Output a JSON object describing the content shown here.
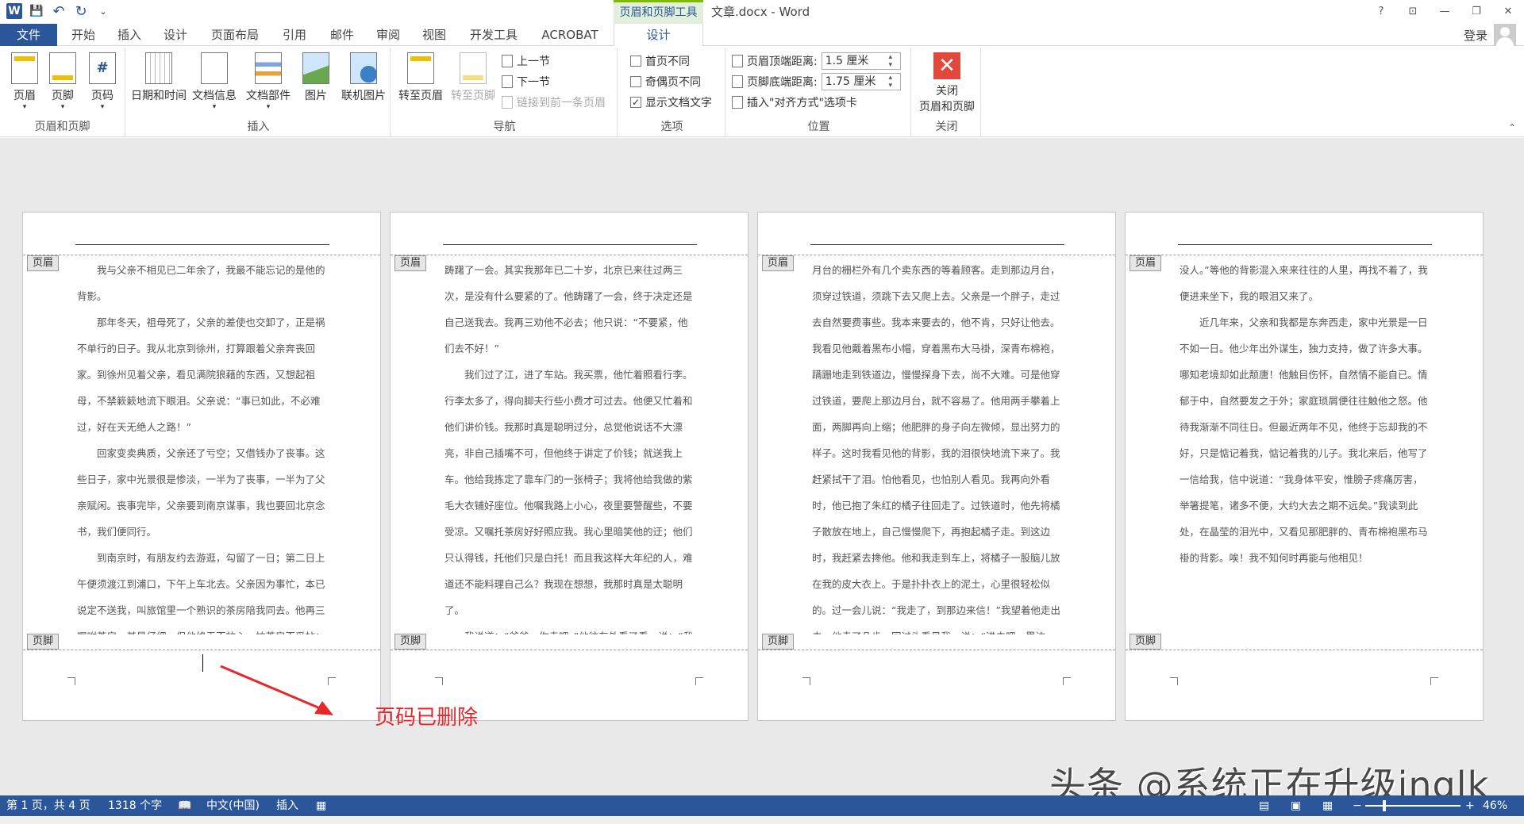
{
  "window": {
    "title": "文章.docx - Word",
    "context_group": "页眉和页脚工具",
    "help": "?",
    "restore_ribbon": "⊡",
    "minimize": "—",
    "maximize": "❐",
    "close": "✕"
  },
  "qat": {
    "word_icon": "W",
    "save_icon": "💾",
    "undo_icon": "↶",
    "redo_icon": "↻",
    "customize_icon": "⌄"
  },
  "tabs": [
    {
      "label": "文件"
    },
    {
      "label": "开始"
    },
    {
      "label": "插入"
    },
    {
      "label": "设计"
    },
    {
      "label": "页面布局"
    },
    {
      "label": "引用"
    },
    {
      "label": "邮件"
    },
    {
      "label": "审阅"
    },
    {
      "label": "视图"
    },
    {
      "label": "开发工具"
    },
    {
      "label": "ACROBAT"
    },
    {
      "label": "设计"
    }
  ],
  "account": {
    "login": "登录"
  },
  "ribbon": {
    "hf": {
      "label": "页眉和页脚",
      "header": "页眉",
      "footer": "页脚",
      "page_number": "页码"
    },
    "insert": {
      "label": "插入",
      "datetime": "日期和时间",
      "docinfo": "文档信息",
      "quickparts": "文档部件",
      "picture": "图片",
      "online_picture": "联机图片"
    },
    "nav": {
      "label": "导航",
      "goto_header": "转至页眉",
      "goto_footer": "转至页脚",
      "prev": "上一节",
      "next": "下一节",
      "link_prev": "链接到前一条页眉"
    },
    "options": {
      "label": "选项",
      "first_page": "首页不同",
      "odd_even": "奇偶页不同",
      "show_text": "显示文档文字",
      "checked": "✓"
    },
    "position": {
      "label": "位置",
      "header_top": "页眉顶端距离:",
      "header_top_val": "1.5 厘米",
      "footer_bottom": "页脚底端距离:",
      "footer_bottom_val": "1.75 厘米",
      "insert_align": "插入\"对齐方式\"选项卡"
    },
    "close": {
      "label": "关闭",
      "button_line1": "关闭",
      "button_line2": "页眉和页脚",
      "icon": "✕"
    },
    "collapse": "⌃"
  },
  "pages": [
    {
      "header_tag": "页眉",
      "footer_tag": "页脚",
      "paragraphs": [
        {
          "text": "我与父亲不相见已二年余了，我最不能忘记的是他的背影。",
          "indent": true
        },
        {
          "text": "那年冬天，祖母死了，父亲的差使也交卸了，正是祸不单行的日子。我从北京到徐州，打算跟着父亲奔丧回家。到徐州见着父亲，看见满院狼藉的东西，又想起祖母，不禁簌簌地流下眼泪。父亲说：“事已如此，不必难过，好在天无绝人之路！”",
          "indent": true
        },
        {
          "text": "回家变卖典质，父亲还了亏空；又借钱办了丧事。这些日子，家中光景很是惨淡，一半为了丧事，一半为了父亲赋闲。丧事完毕，父亲要到南京谋事，我也要回北京念书，我们便同行。",
          "indent": true
        },
        {
          "text": "到南京时，有朋友约去游逛，勾留了一日；第二日上午便须渡江到浦口，下午上车北去。父亲因为事忙，本已说定不送我，叫旅馆里一个熟识的茶房陪我同去。他再三嘱咐茶房，甚是仔细。但他终于不放心，怕茶房不妥帖；颇",
          "indent": true
        }
      ]
    },
    {
      "header_tag": "页眉",
      "footer_tag": "页脚",
      "paragraphs": [
        {
          "text": "踌躇了一会。其实我那年已二十岁，北京已来往过两三次，是没有什么要紧的了。他踌躇了一会，终于决定还是自己送我去。我再三劝他不必去；他只说：“不要紧，他们去不好！”",
          "indent": false
        },
        {
          "text": "我们过了江，进了车站。我买票，他忙着照看行李。行李太多了，得向脚夫行些小费才可过去。他便又忙着和他们讲价钱。我那时真是聪明过分，总觉他说话不大漂亮，非自己插嘴不可，但他终于讲定了价钱；就送我上车。他给我拣定了靠车门的一张椅子；我将他给我做的紫毛大衣铺好座位。他嘱我路上小心，夜里要警醒些，不要受凉。又嘱托茶房好好照应我。我心里暗笑他的迂；他们只认得钱，托他们只是白托！而且我这样大年纪的人，难道还不能料理自己么？我现在想想，我那时真是太聪明了。",
          "indent": true
        },
        {
          "text": "我说道：“爸爸，你走吧。”他往车外看了看，说：“我买几个橘子去。你就在此地，不要走动。”我看那边",
          "indent": true
        }
      ]
    },
    {
      "header_tag": "页眉",
      "footer_tag": "页脚",
      "paragraphs": [
        {
          "text": "月台的栅栏外有几个卖东西的等着顾客。走到那边月台，须穿过铁道，须跳下去又爬上去。父亲是一个胖子，走过去自然要费事些。我本来要去的，他不肯，只好让他去。我看见他戴着黑布小帽，穿着黑布大马褂，深青布棉袍，蹒跚地走到铁道边，慢慢探身下去，尚不大难。可是他穿过铁道，要爬上那边月台，就不容易了。他用两手攀着上面，两脚再向上缩；他肥胖的身子向左微倾，显出努力的样子。这时我看见他的背影，我的泪很快地流下来了。我赶紧拭干了泪。怕他看见，也怕别人看见。我再向外看时，他已抱了朱红的橘子往回走了。过铁道时，他先将橘子散放在地上，自己慢慢爬下，再抱起橘子走。到这边时，我赶紧去搀他。他和我走到车上，将橘子一股脑儿放在我的皮大衣上。于是扑扑衣上的泥土，心里很轻松似的。过一会儿说：“我走了，到那边来信！”我望着他走出去。他走了几步，回过头看见我，说：“进去吧，里边",
          "indent": false
        }
      ]
    },
    {
      "header_tag": "页眉",
      "footer_tag": "页脚",
      "paragraphs": [
        {
          "text": "没人。”等他的背影混入来来往往的人里，再找不着了，我便进来坐下，我的眼泪又来了。",
          "indent": false
        },
        {
          "text": "近几年来，父亲和我都是东奔西走，家中光景是一日不如一日。他少年出外谋生，独力支持，做了许多大事。哪知老境却如此颓唐！他触目伤怀，自然情不能自已。情郁于中，自然要发之于外；家庭琐屑便往往触他之怒。他待我渐渐不同往日。但最近两年不见，他终于忘却我的不好，只是惦记着我，惦记着我的儿子。我北来后，他写了一信给我，信中说道：“我身体平安，惟膀子疼痛厉害，举箸提笔，诸多不便，大约大去之期不远矣。”我读到此处，在晶莹的泪光中，又看见那肥胖的、青布棉袍黑布马褂的背影。唉！我不知何时再能与他相见！",
          "indent": true
        }
      ]
    }
  ],
  "annotation": {
    "text": "页码已删除"
  },
  "watermark": "头条 @系统正在升级inglk",
  "status": {
    "page": "第 1 页，共 4 页",
    "words": "1318 个字",
    "proof_icon": "📖",
    "language": "中文(中国)",
    "mode": "插入",
    "macro_icon": "▦",
    "zoom_minus": "−",
    "zoom_plus": "+",
    "zoom": "46%"
  }
}
